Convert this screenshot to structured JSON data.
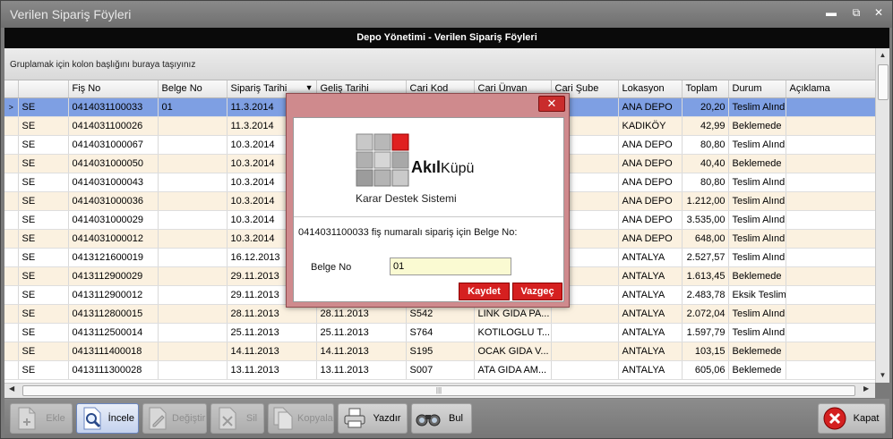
{
  "window": {
    "title": "Verilen Sipariş Föyleri",
    "controls": [
      "x",
      "▬",
      "⧉",
      "✕"
    ]
  },
  "header": {
    "title": "Depo Yönetimi - Verilen Sipariş Föyleri"
  },
  "group_panel": {
    "text": "Gruplamak için kolon başlığını buraya taşıyınız"
  },
  "grid": {
    "columns": [
      "",
      "",
      "Fiş No",
      "Belge No",
      "Sipariş Tarihi",
      "Geliş Tarihi",
      "Cari Kod",
      "Cari Ünvan",
      "Cari Şube",
      "Lokasyon",
      "Toplam",
      "Durum",
      "Açıklama"
    ],
    "sort_indicator": "▼",
    "selected_marker": ">",
    "rows": [
      [
        "SE",
        "0414031100033",
        "01",
        "11.3.2014",
        "",
        "",
        "",
        "",
        "ANA DEPO",
        "20,20",
        "Teslim Alındı",
        ""
      ],
      [
        "SE",
        "0414031100026",
        "",
        "11.3.2014",
        "",
        "",
        "",
        "",
        "KADIKÖY",
        "42,99",
        "Beklemede",
        ""
      ],
      [
        "SE",
        "0414031000067",
        "",
        "10.3.2014",
        "",
        "",
        "",
        "",
        "ANA DEPO",
        "80,80",
        "Teslim Alındı",
        ""
      ],
      [
        "SE",
        "0414031000050",
        "",
        "10.3.2014",
        "",
        "",
        "",
        "",
        "ANA DEPO",
        "40,40",
        "Beklemede",
        ""
      ],
      [
        "SE",
        "0414031000043",
        "",
        "10.3.2014",
        "",
        "",
        "",
        "",
        "ANA DEPO",
        "80,80",
        "Teslim Alındı",
        ""
      ],
      [
        "SE",
        "0414031000036",
        "",
        "10.3.2014",
        "",
        "",
        "",
        "",
        "ANA DEPO",
        "1.212,00",
        "Teslim Alındı",
        ""
      ],
      [
        "SE",
        "0414031000029",
        "",
        "10.3.2014",
        "",
        "",
        "",
        "",
        "ANA DEPO",
        "3.535,00",
        "Teslim Alındı",
        ""
      ],
      [
        "SE",
        "0414031000012",
        "",
        "10.3.2014",
        "",
        "",
        "",
        "",
        "ANA DEPO",
        "648,00",
        "Teslim Alındı",
        ""
      ],
      [
        "SE",
        "0413121600019",
        "",
        "16.12.2013",
        "",
        "",
        "",
        "",
        "ANTALYA",
        "2.527,57",
        "Teslim Alındı",
        ""
      ],
      [
        "SE",
        "0413112900029",
        "",
        "29.11.2013",
        "",
        "",
        "",
        "",
        "ANTALYA",
        "1.613,45",
        "Beklemede",
        ""
      ],
      [
        "SE",
        "0413112900012",
        "",
        "29.11.2013",
        "",
        "",
        "",
        "",
        "ANTALYA",
        "2.483,78",
        "Eksik Teslim",
        ""
      ],
      [
        "SE",
        "0413112800015",
        "",
        "28.11.2013",
        "28.11.2013",
        "S542",
        "LINK GIDA PA...",
        "",
        "ANTALYA",
        "2.072,04",
        "Teslim Alındı",
        ""
      ],
      [
        "SE",
        "0413112500014",
        "",
        "25.11.2013",
        "25.11.2013",
        "S764",
        "KOTILOGLU T...",
        "",
        "ANTALYA",
        "1.597,79",
        "Teslim Alındı",
        ""
      ],
      [
        "SE",
        "0413111400018",
        "",
        "14.11.2013",
        "14.11.2013",
        "S195",
        "OCAK GIDA V...",
        "",
        "ANTALYA",
        "103,15",
        "Beklemede",
        ""
      ],
      [
        "SE",
        "0413111300028",
        "",
        "13.11.2013",
        "13.11.2013",
        "S007",
        "ATA GIDA AM...",
        "",
        "ANTALYA",
        "605,06",
        "Beklemede",
        ""
      ]
    ]
  },
  "toolbar": {
    "buttons": [
      {
        "label": "Ekle",
        "icon": "add-document-icon",
        "enabled": false
      },
      {
        "label": "İncele",
        "icon": "magnifier-icon",
        "enabled": true
      },
      {
        "label": "Değiştir",
        "icon": "edit-document-icon",
        "enabled": false
      },
      {
        "label": "Sil",
        "icon": "delete-document-icon",
        "enabled": false
      },
      {
        "label": "Kopyala",
        "icon": "copy-document-icon",
        "enabled": false
      },
      {
        "label": "Yazdır",
        "icon": "printer-icon",
        "enabled": true
      },
      {
        "label": "Bul",
        "icon": "binoculars-icon",
        "enabled": true
      }
    ],
    "close_label": "Kapat"
  },
  "dialog": {
    "close_glyph": "✕",
    "brand_bold": "Akıl",
    "brand_light": "Küpü",
    "subtitle": "Karar Destek Sistemi",
    "message": "0414031100033 fiş numaralı sipariş için Belge No:",
    "field_label": "Belge No",
    "field_value": "01",
    "save_label": "Kaydet",
    "cancel_label": "Vazgeç"
  },
  "colors": {
    "selected_row": "#7e9fe3",
    "alt_row": "#fbf1e0",
    "dialog_button": "#d52020",
    "input_bg": "#fafad2"
  }
}
